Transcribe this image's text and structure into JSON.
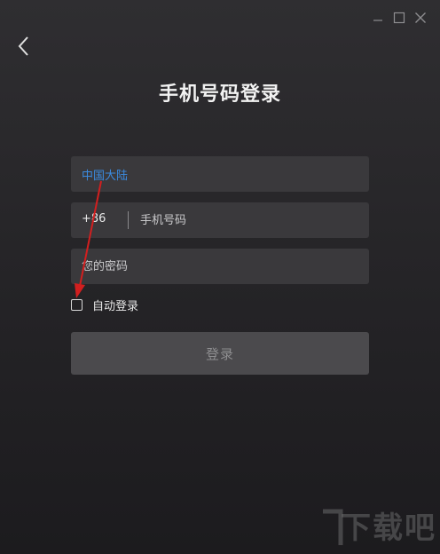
{
  "window": {
    "controls": [
      "minimize-icon",
      "maximize-icon",
      "close-icon"
    ]
  },
  "header": {
    "back_icon": "chevron-left-icon",
    "title": "手机号码登录"
  },
  "form": {
    "region": "中国大陆",
    "country_code": "+86",
    "phone_placeholder": "手机号码",
    "password_placeholder": "您的密码",
    "auto_login_label": "自动登录",
    "auto_login_checked": false,
    "login_button": "登录"
  },
  "colors": {
    "background": "#262528",
    "field": "#3a393c",
    "region_text": "#3b8be0",
    "button": "#4b4a4d",
    "annotation_arrow": "#d21f1f"
  },
  "watermark": {
    "text": "下载吧"
  }
}
